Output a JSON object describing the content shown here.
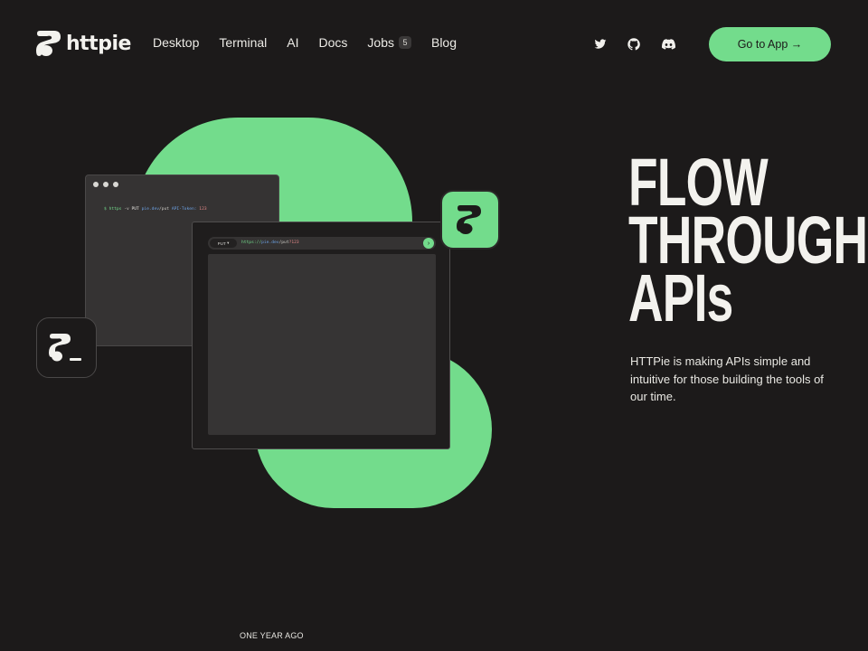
{
  "brand": {
    "name": "httpie"
  },
  "nav": {
    "items": [
      {
        "label": "Desktop"
      },
      {
        "label": "Terminal"
      },
      {
        "label": "AI"
      },
      {
        "label": "Docs"
      },
      {
        "label": "Jobs",
        "badge": "5"
      },
      {
        "label": "Blog"
      }
    ]
  },
  "social": [
    "twitter-icon",
    "github-icon",
    "discord-icon"
  ],
  "cta": {
    "label": "Go to App →"
  },
  "illustration": {
    "terminal": {
      "prompt": "$",
      "cmd": "https",
      "flag": "-v",
      "method": "PUT",
      "host": "pie.dev",
      "path": "/put",
      "key": "API-Token:",
      "value": "123"
    },
    "desktop": {
      "method": "PUT",
      "url_scheme": "https://",
      "url_host": "pie.dev",
      "url_path": "/put",
      "url_query": "?123"
    }
  },
  "hero": {
    "headline": [
      "FLOW",
      "THROUGH",
      "APIs"
    ],
    "subtext": "HTTPie is making APIs simple and intuitive for those building the tools of our time."
  },
  "footer": {
    "label": "ONE YEAR AGO"
  },
  "colors": {
    "accent": "#73dc8c",
    "background": "#1c1a1a",
    "text": "#f3f2ee"
  }
}
